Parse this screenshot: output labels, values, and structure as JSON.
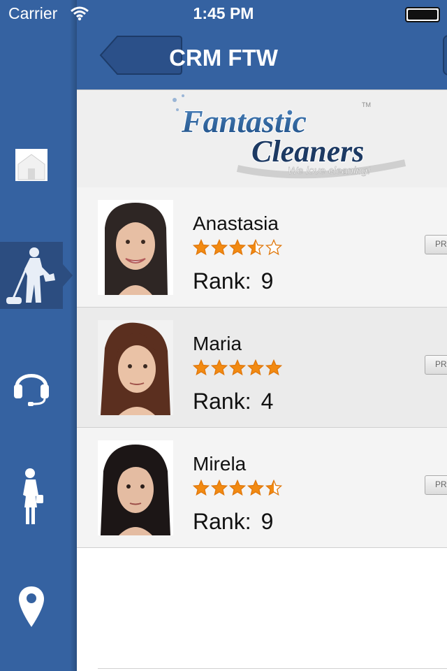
{
  "status_bar": {
    "carrier": "Carrier",
    "time": "1:45 PM",
    "wifi_icon": "wifi-icon",
    "battery_icon": "battery-icon"
  },
  "sidebar": {
    "items": [
      {
        "icon": "home-icon",
        "active": false
      },
      {
        "icon": "cleaner-icon",
        "active": true
      },
      {
        "icon": "headset-icon",
        "active": false
      },
      {
        "icon": "businesswoman-icon",
        "active": false
      },
      {
        "icon": "location-pin-icon",
        "active": false
      }
    ]
  },
  "nav": {
    "title": "CRM FTW",
    "back_icon": "back-arrow-icon"
  },
  "logo": {
    "line1": "Fantastic",
    "line2": "Cleaners",
    "tagline": "We love cleaning!",
    "tm": "TM"
  },
  "employees": [
    {
      "name": "Anastasia",
      "rating": 3.5,
      "rank_label": "Rank:",
      "rank": "9",
      "button_label": "PR"
    },
    {
      "name": "Maria",
      "rating": 5,
      "rank_label": "Rank:",
      "rank": "4",
      "button_label": "PR"
    },
    {
      "name": "Mirela",
      "rating": 4.5,
      "rank_label": "Rank:",
      "rank": "9",
      "button_label": "PR"
    }
  ],
  "colors": {
    "brand_blue": "#3562a1",
    "active_blue": "#2c4d80",
    "star_orange": "#f28a12"
  }
}
